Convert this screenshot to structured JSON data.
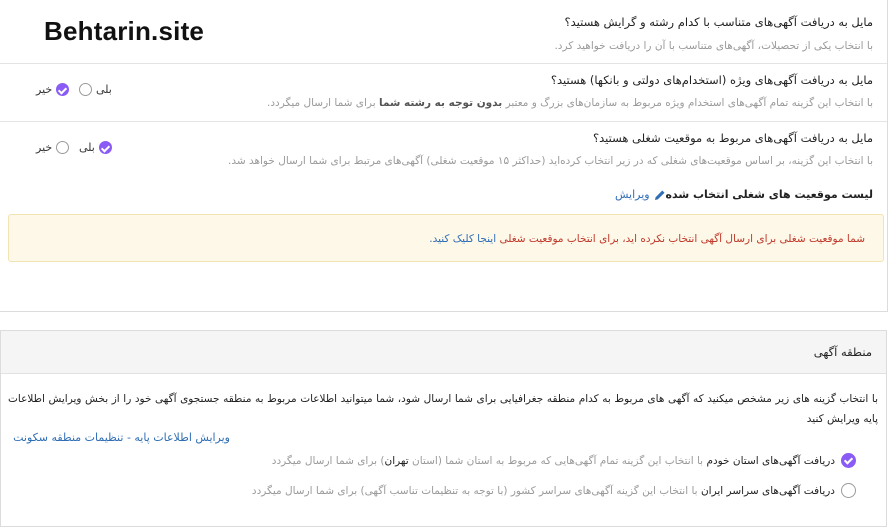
{
  "brand": "Behtarin.site",
  "colors": {
    "accent": "#8a5cf5",
    "link": "#2f6db5",
    "error": "#c0392b",
    "alert_bg": "#fdf8e8"
  },
  "q1": {
    "title": "مایل به دریافت آگهی‌های متناسب با کدام رشته و گرایش هستید؟",
    "desc": "با انتخاب یکی از تحصیلات، آگهی‌های متناسب با آن را دریافت خواهید کرد."
  },
  "q2": {
    "title": "مایل به دریافت آگهی‌های ویژه (استخدام‌های دولتی و بانکها) هستید؟",
    "desc_pre": "با انتخاب این گزینه تمام آگهی‌های استخدام ویژه مربوط به سازمان‌های بزرگ و معتبر ",
    "desc_bold": "بدون توجه به رشته شما",
    "desc_post": " برای شما ارسال میگردد.",
    "yes": "بلی",
    "no": "خیر",
    "selected": "no"
  },
  "q3": {
    "title": "مایل به دریافت آگهی‌های مربوط به موقعیت شغلی هستید؟",
    "desc": "با انتخاب این گزینه، بر اساس موقعیت‌های شغلی که در زیر انتخاب کرده‌اید (حداکثر ۱۵ موقعیت شغلی) آگهی‌های مرتبط برای شما ارسال خواهد شد.",
    "yes": "بلی",
    "no": "خیر",
    "selected": "yes"
  },
  "positions": {
    "list_title": "لیست موقعیت های شغلی انتخاب شده",
    "edit": "ویرایش",
    "alert_pre": "شما موقعیت شغلی برای ارسال آگهی انتخاب نکرده اید، برای انتخاب موقعیت شغلی ",
    "alert_link": "اینجا کلیک کنید.",
    "icons": {
      "edit": "pencil-icon"
    }
  },
  "region": {
    "title": "منطقه آگهی",
    "desc": "با انتخاب گزینه های زیر مشخص میکنید که آگهی های مربوط به کدام منطقه جغرافیایی برای شما ارسال شود، شما میتوانید اطلاعات مربوط به منطقه جستجوی آگهی خود را از بخش ویرایش اطلاعات پایه ویرایش کنید",
    "links": "ویرایش اطلاعات پایه - تنظیمات منطقه سکونت",
    "opt1_bold": "دریافت آگهی‌های استان خودم",
    "opt1_pre": " با انتخاب این گزینه تمام آگهی‌هایی که مربوط به استان شما (استان ",
    "opt1_city": "تهران",
    "opt1_post": ") برای شما ارسال میگردد",
    "opt2_bold": "دریافت آگهی‌های سراسر ایران",
    "opt2_rest": " با انتخاب این گزینه آگهی‌های سراسر کشور (با توجه به تنظیمات تناسب آگهی) برای شما ارسال میگردد",
    "selected": "province"
  }
}
